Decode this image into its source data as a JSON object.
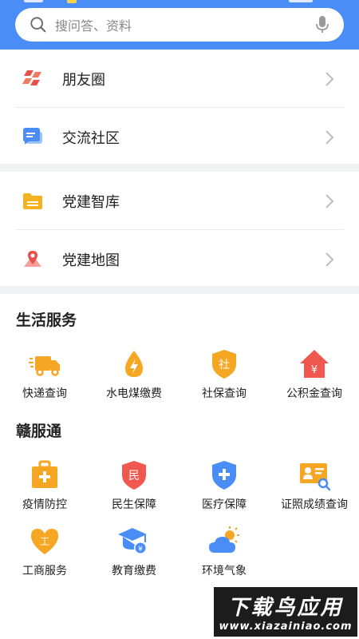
{
  "search": {
    "placeholder": "搜问答、资料",
    "icons": [
      "search-icon",
      "microphone-icon"
    ]
  },
  "menu_group_1": [
    {
      "label": "朋友圈",
      "icon": "moments-icon"
    },
    {
      "label": "交流社区",
      "icon": "chat-community-icon"
    }
  ],
  "menu_group_2": [
    {
      "label": "党建智库",
      "icon": "folder-icon"
    },
    {
      "label": "党建地图",
      "icon": "map-pin-icon"
    }
  ],
  "life_services": {
    "title": "生活服务",
    "items": [
      {
        "label": "快递查询",
        "icon": "delivery-truck-icon"
      },
      {
        "label": "水电煤缴费",
        "icon": "utility-drop-icon"
      },
      {
        "label": "社保查询",
        "icon": "social-security-shield-icon"
      },
      {
        "label": "公积金查询",
        "icon": "housing-fund-icon"
      }
    ]
  },
  "ganfutong": {
    "title": "赣服通",
    "items": [
      {
        "label": "疫情防控",
        "icon": "medical-kit-icon"
      },
      {
        "label": "民生保障",
        "icon": "livelihood-shield-icon"
      },
      {
        "label": "医疗保障",
        "icon": "medical-shield-icon"
      },
      {
        "label": "证照成绩查询",
        "icon": "id-card-search-icon"
      },
      {
        "label": "工商服务",
        "icon": "business-heart-icon"
      },
      {
        "label": "教育缴费",
        "icon": "education-fee-icon"
      },
      {
        "label": "环境气象",
        "icon": "weather-icon"
      }
    ]
  },
  "watermark": {
    "line1": "下载鸟应用",
    "line2": "www.xiazainiao.com"
  },
  "colors": {
    "header_blue": "#4a8df6",
    "orange": "#f5a623",
    "red": "#f0574f",
    "blue": "#4a8df6"
  }
}
